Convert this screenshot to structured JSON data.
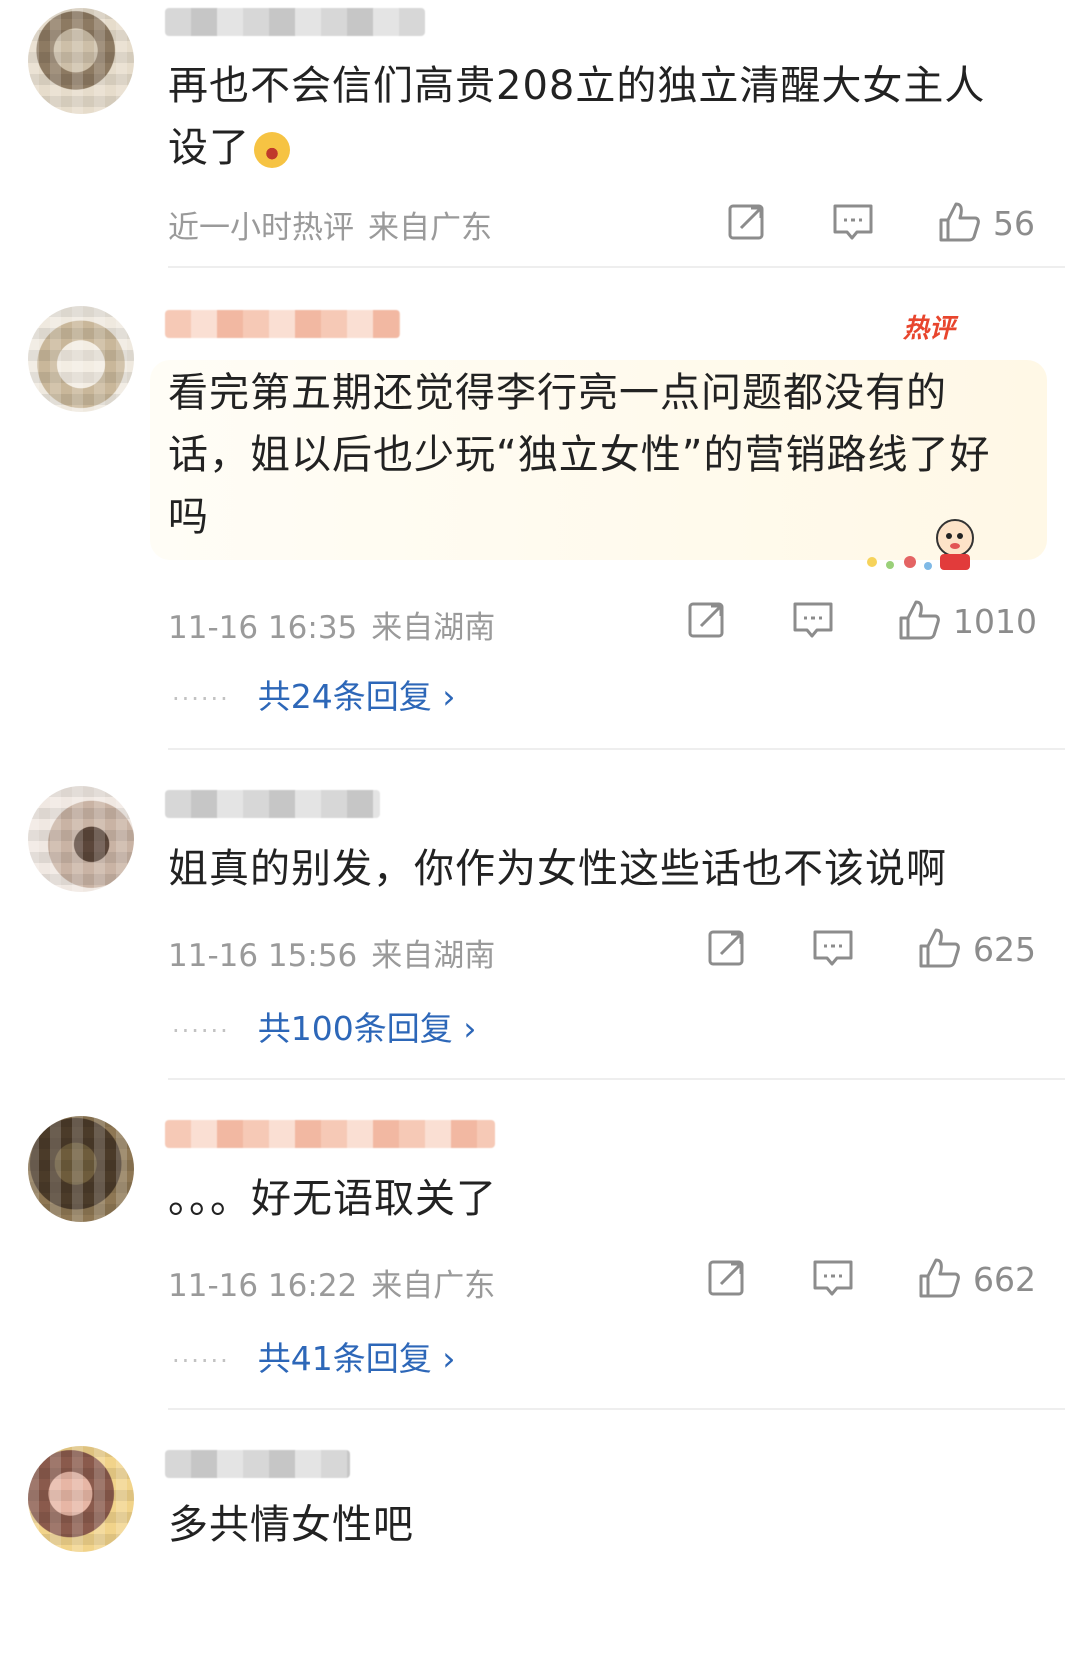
{
  "comments": [
    {
      "text": "再也不会信们高贵208立的独立清醒大女主人设了",
      "emoji": "crying-laughing-emoji",
      "time": "近一小时热评",
      "location": "来自广东",
      "likes": "56"
    },
    {
      "hot_tag": "热评",
      "text": "看完第五期还觉得李行亮一点问题都没有的话，姐以后也少玩“独立女性”的营销路线了好吗",
      "time": "11-16 16:35",
      "location": "来自湖南",
      "likes": "1010",
      "replies": "共24条回复 ›"
    },
    {
      "text": "姐真的别发，你作为女性这些话也不该说啊",
      "time": "11-16 15:56",
      "location": "来自湖南",
      "likes": "625",
      "replies": "共100条回复 ›"
    },
    {
      "text": "。。。好无语取关了",
      "time": "11-16 16:22",
      "location": "来自广东",
      "likes": "662",
      "replies": "共41条回复 ›"
    },
    {
      "text": "多共情女性吧"
    }
  ],
  "reply_dots": "······",
  "colors": {
    "link": "#2d67b8",
    "meta": "#9a9a9a",
    "hot": "#e8452d"
  }
}
